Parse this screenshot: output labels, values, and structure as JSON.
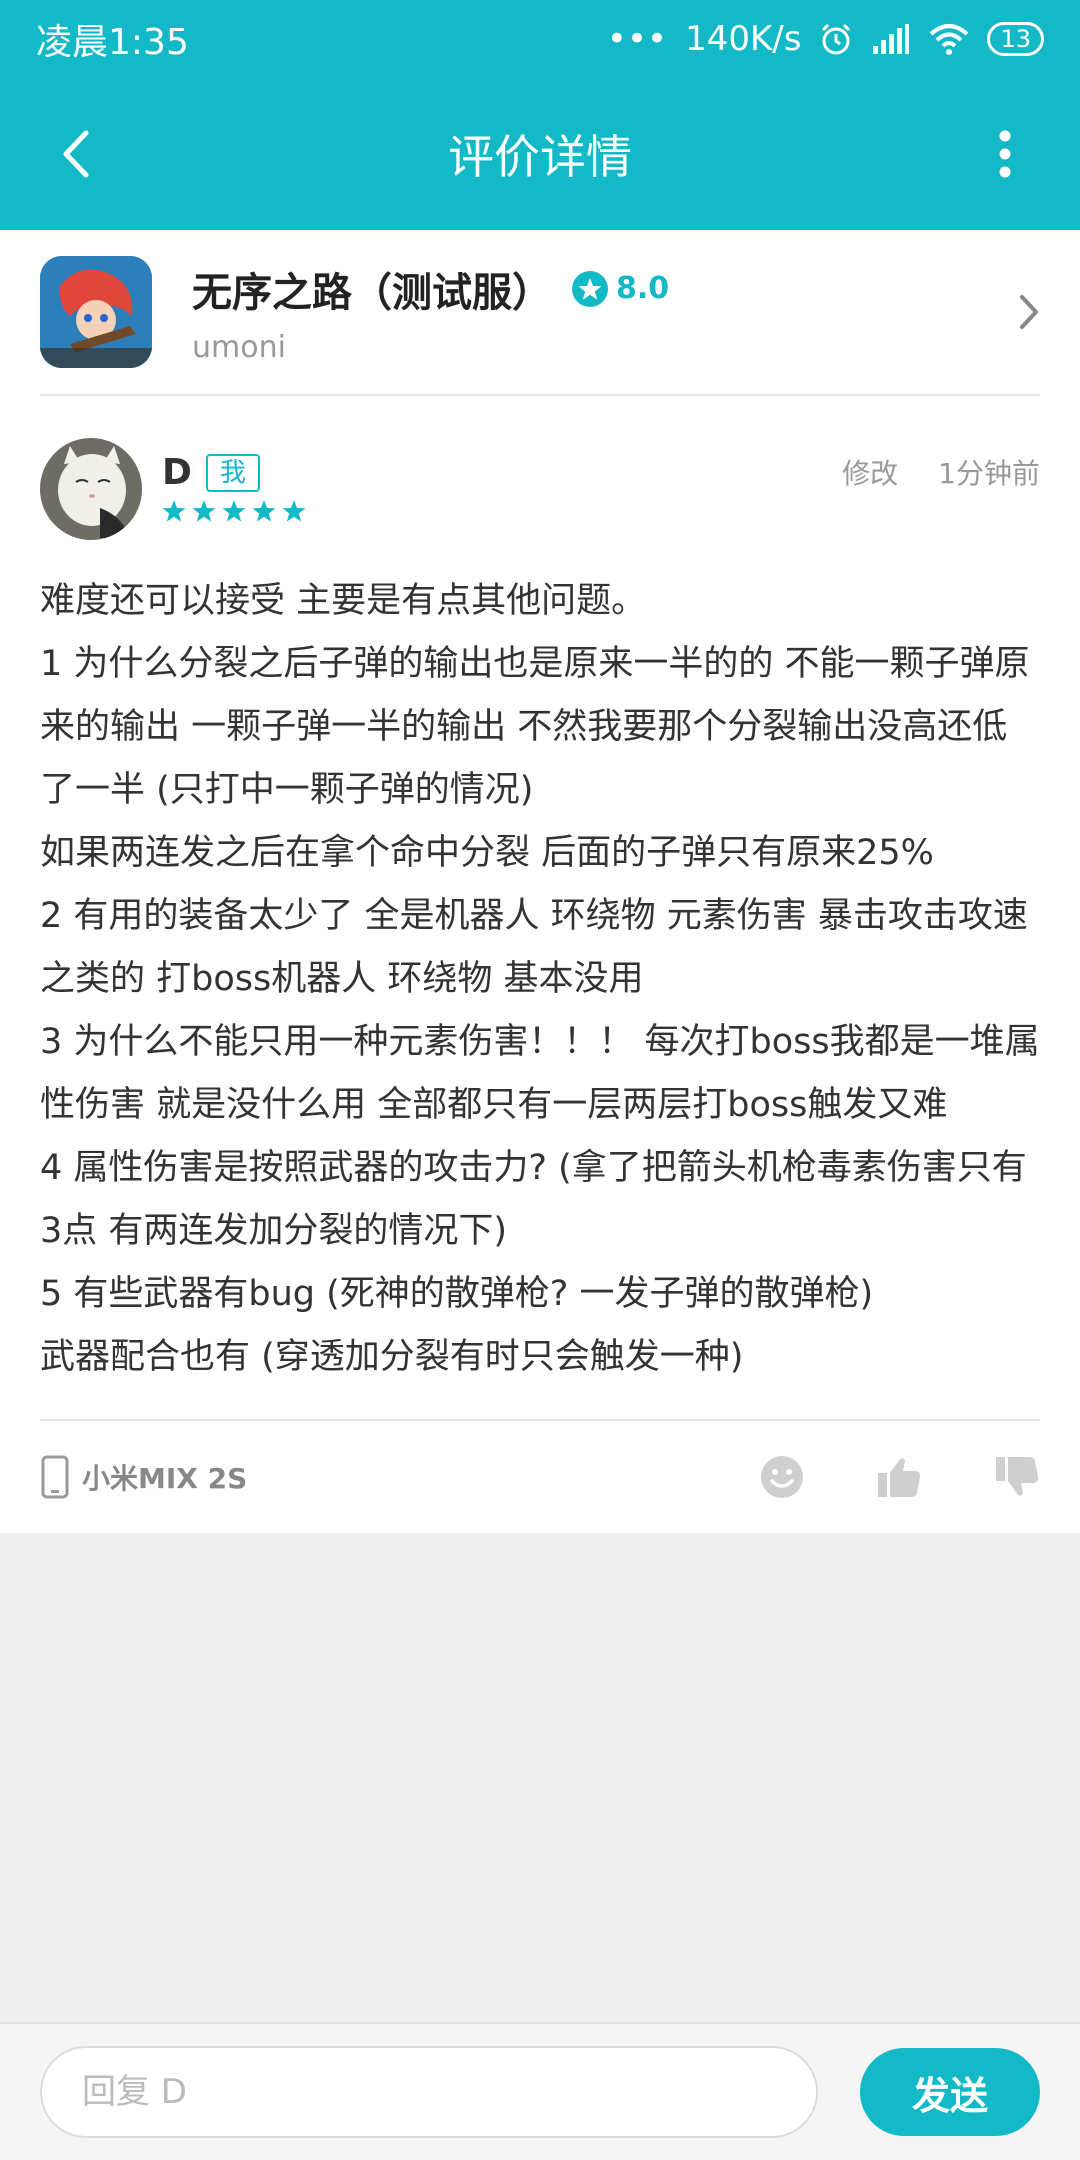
{
  "status_bar": {
    "time": "凌晨1:35",
    "network_speed": "140K/s",
    "battery": "13"
  },
  "app_bar": {
    "title": "评价详情"
  },
  "app": {
    "name": "无序之路（测试服）",
    "rating": "8.0",
    "developer": "umoni"
  },
  "review": {
    "username": "D",
    "me_badge": "我",
    "stars": 5,
    "edit_label": "修改",
    "time": "1分钟前",
    "lines": [
      "难度还可以接受 主要是有点其他问题。",
      "1 为什么分裂之后子弹的输出也是原来一半的的 不能一颗子弹原来的输出 一颗子弹一半的输出 不然我要那个分裂输出没高还低了一半 (只打中一颗子弹的情况)",
      "如果两连发之后在拿个命中分裂 后面的子弹只有原来25%",
      "2 有用的装备太少了 全是机器人 环绕物 元素伤害 暴击攻击攻速之类的 打boss机器人 环绕物 基本没用",
      "3 为什么不能只用一种元素伤害！！！ 每次打boss我都是一堆属性伤害 就是没什么用 全部都只有一层两层打boss触发又难",
      "4 属性伤害是按照武器的攻击力? (拿了把箭头机枪毒素伤害只有3点 有两连发加分裂的情况下)",
      "5 有些武器有bug (死神的散弹枪? 一发子弹的散弹枪)",
      "武器配合也有 (穿透加分裂有时只会触发一种)"
    ],
    "device": "小米MIX 2S"
  },
  "reply": {
    "placeholder": "回复 D",
    "send_label": "发送"
  },
  "colors": {
    "accent": "#14b9c8"
  }
}
